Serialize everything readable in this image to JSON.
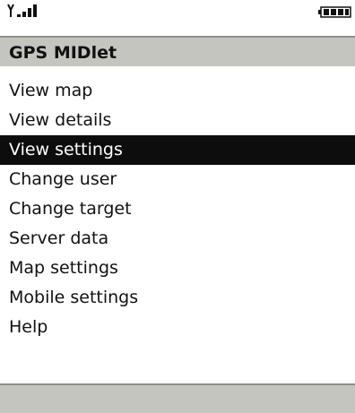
{
  "status_bar": {
    "signal_icon": "antenna-signal-icon",
    "battery_icon": "battery-icon"
  },
  "title": "GPS MIDlet",
  "menu": {
    "items": [
      {
        "label": "View map",
        "selected": false
      },
      {
        "label": "View details",
        "selected": false
      },
      {
        "label": "View settings",
        "selected": true
      },
      {
        "label": "Change user",
        "selected": false
      },
      {
        "label": "Change target",
        "selected": false
      },
      {
        "label": "Server data",
        "selected": false
      },
      {
        "label": "Map settings",
        "selected": false
      },
      {
        "label": "Mobile settings",
        "selected": false
      },
      {
        "label": "Help",
        "selected": false
      }
    ]
  },
  "colors": {
    "bar_background": "#c5c5c0",
    "selection_background": "#0d0d0d",
    "selection_text": "#ffffff"
  }
}
